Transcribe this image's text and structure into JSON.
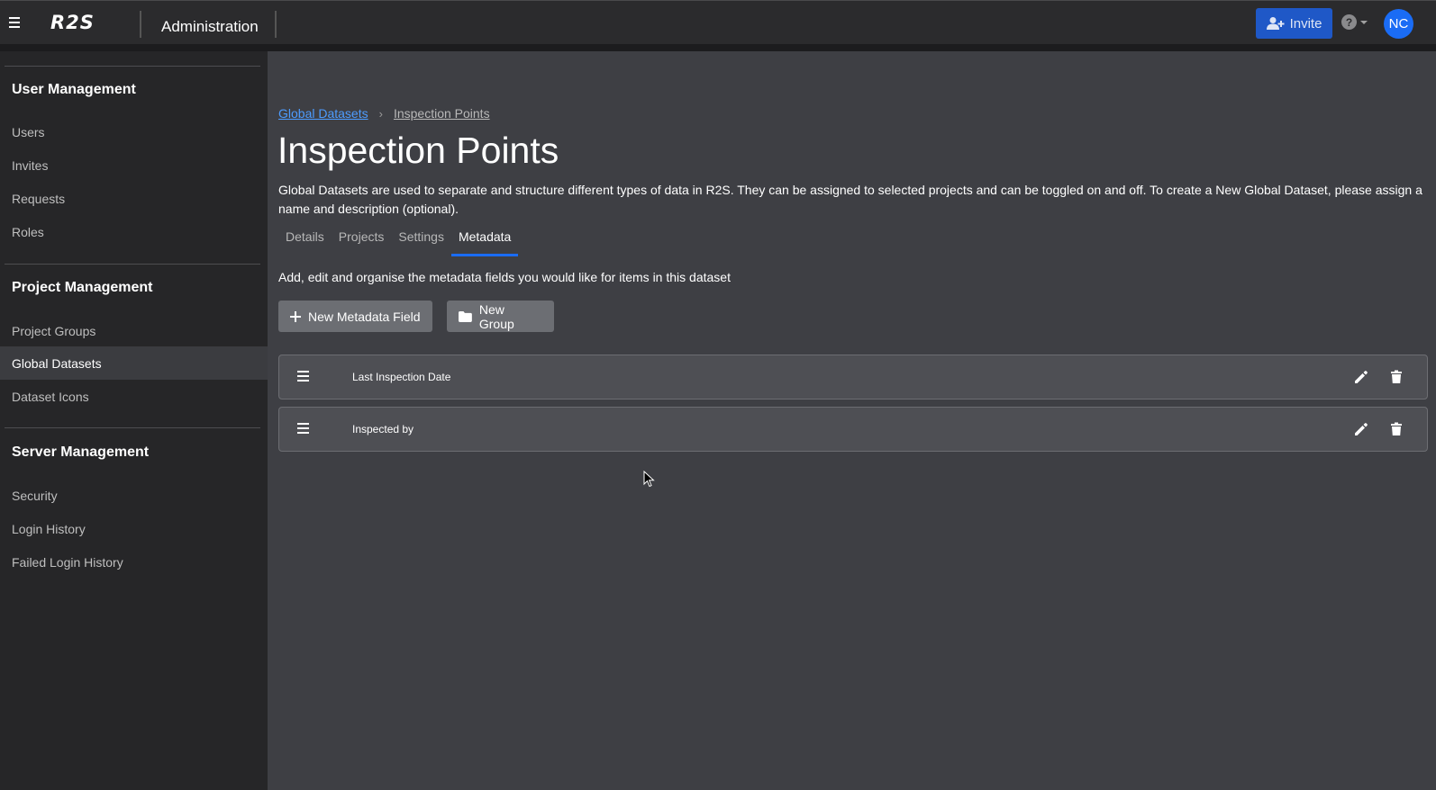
{
  "header": {
    "logo": "R2S",
    "title": "Administration",
    "invite_label": "Invite",
    "help_label": "?",
    "avatar_initials": "NC"
  },
  "sidebar": {
    "sections": [
      {
        "title": "User Management",
        "items": [
          {
            "label": "Users"
          },
          {
            "label": "Invites"
          },
          {
            "label": "Requests"
          },
          {
            "label": "Roles"
          }
        ]
      },
      {
        "title": "Project Management",
        "items": [
          {
            "label": "Project Groups"
          },
          {
            "label": "Global Datasets",
            "active": true
          },
          {
            "label": "Dataset Icons"
          }
        ]
      },
      {
        "title": "Server Management",
        "items": [
          {
            "label": "Security"
          },
          {
            "label": "Login History"
          },
          {
            "label": "Failed Login History"
          }
        ]
      }
    ]
  },
  "main": {
    "breadcrumb": {
      "parent": "Global Datasets",
      "separator": "›",
      "current": "Inspection Points"
    },
    "title": "Inspection Points",
    "description": "Global Datasets are used to separate and structure different types of data in R2S. They can be assigned to selected projects and can be toggled on and off. To create a New Global Dataset, please assign a name and description (optional).",
    "tabs": [
      {
        "label": "Details"
      },
      {
        "label": "Projects"
      },
      {
        "label": "Settings"
      },
      {
        "label": "Metadata",
        "active": true
      }
    ],
    "subtext": "Add, edit and organise the metadata fields you would like for items in this dataset",
    "buttons": {
      "new_field": "New Metadata Field",
      "new_group": "New Group"
    },
    "fields": [
      {
        "label": "Last Inspection Date"
      },
      {
        "label": "Inspected by"
      }
    ]
  },
  "colors": {
    "accent": "#1a6cf5",
    "invite_button": "#1f58c7",
    "link": "#4d9cff",
    "background": "#3e3f44",
    "sidebar": "#262628",
    "topbar": "#2b2b2d"
  }
}
